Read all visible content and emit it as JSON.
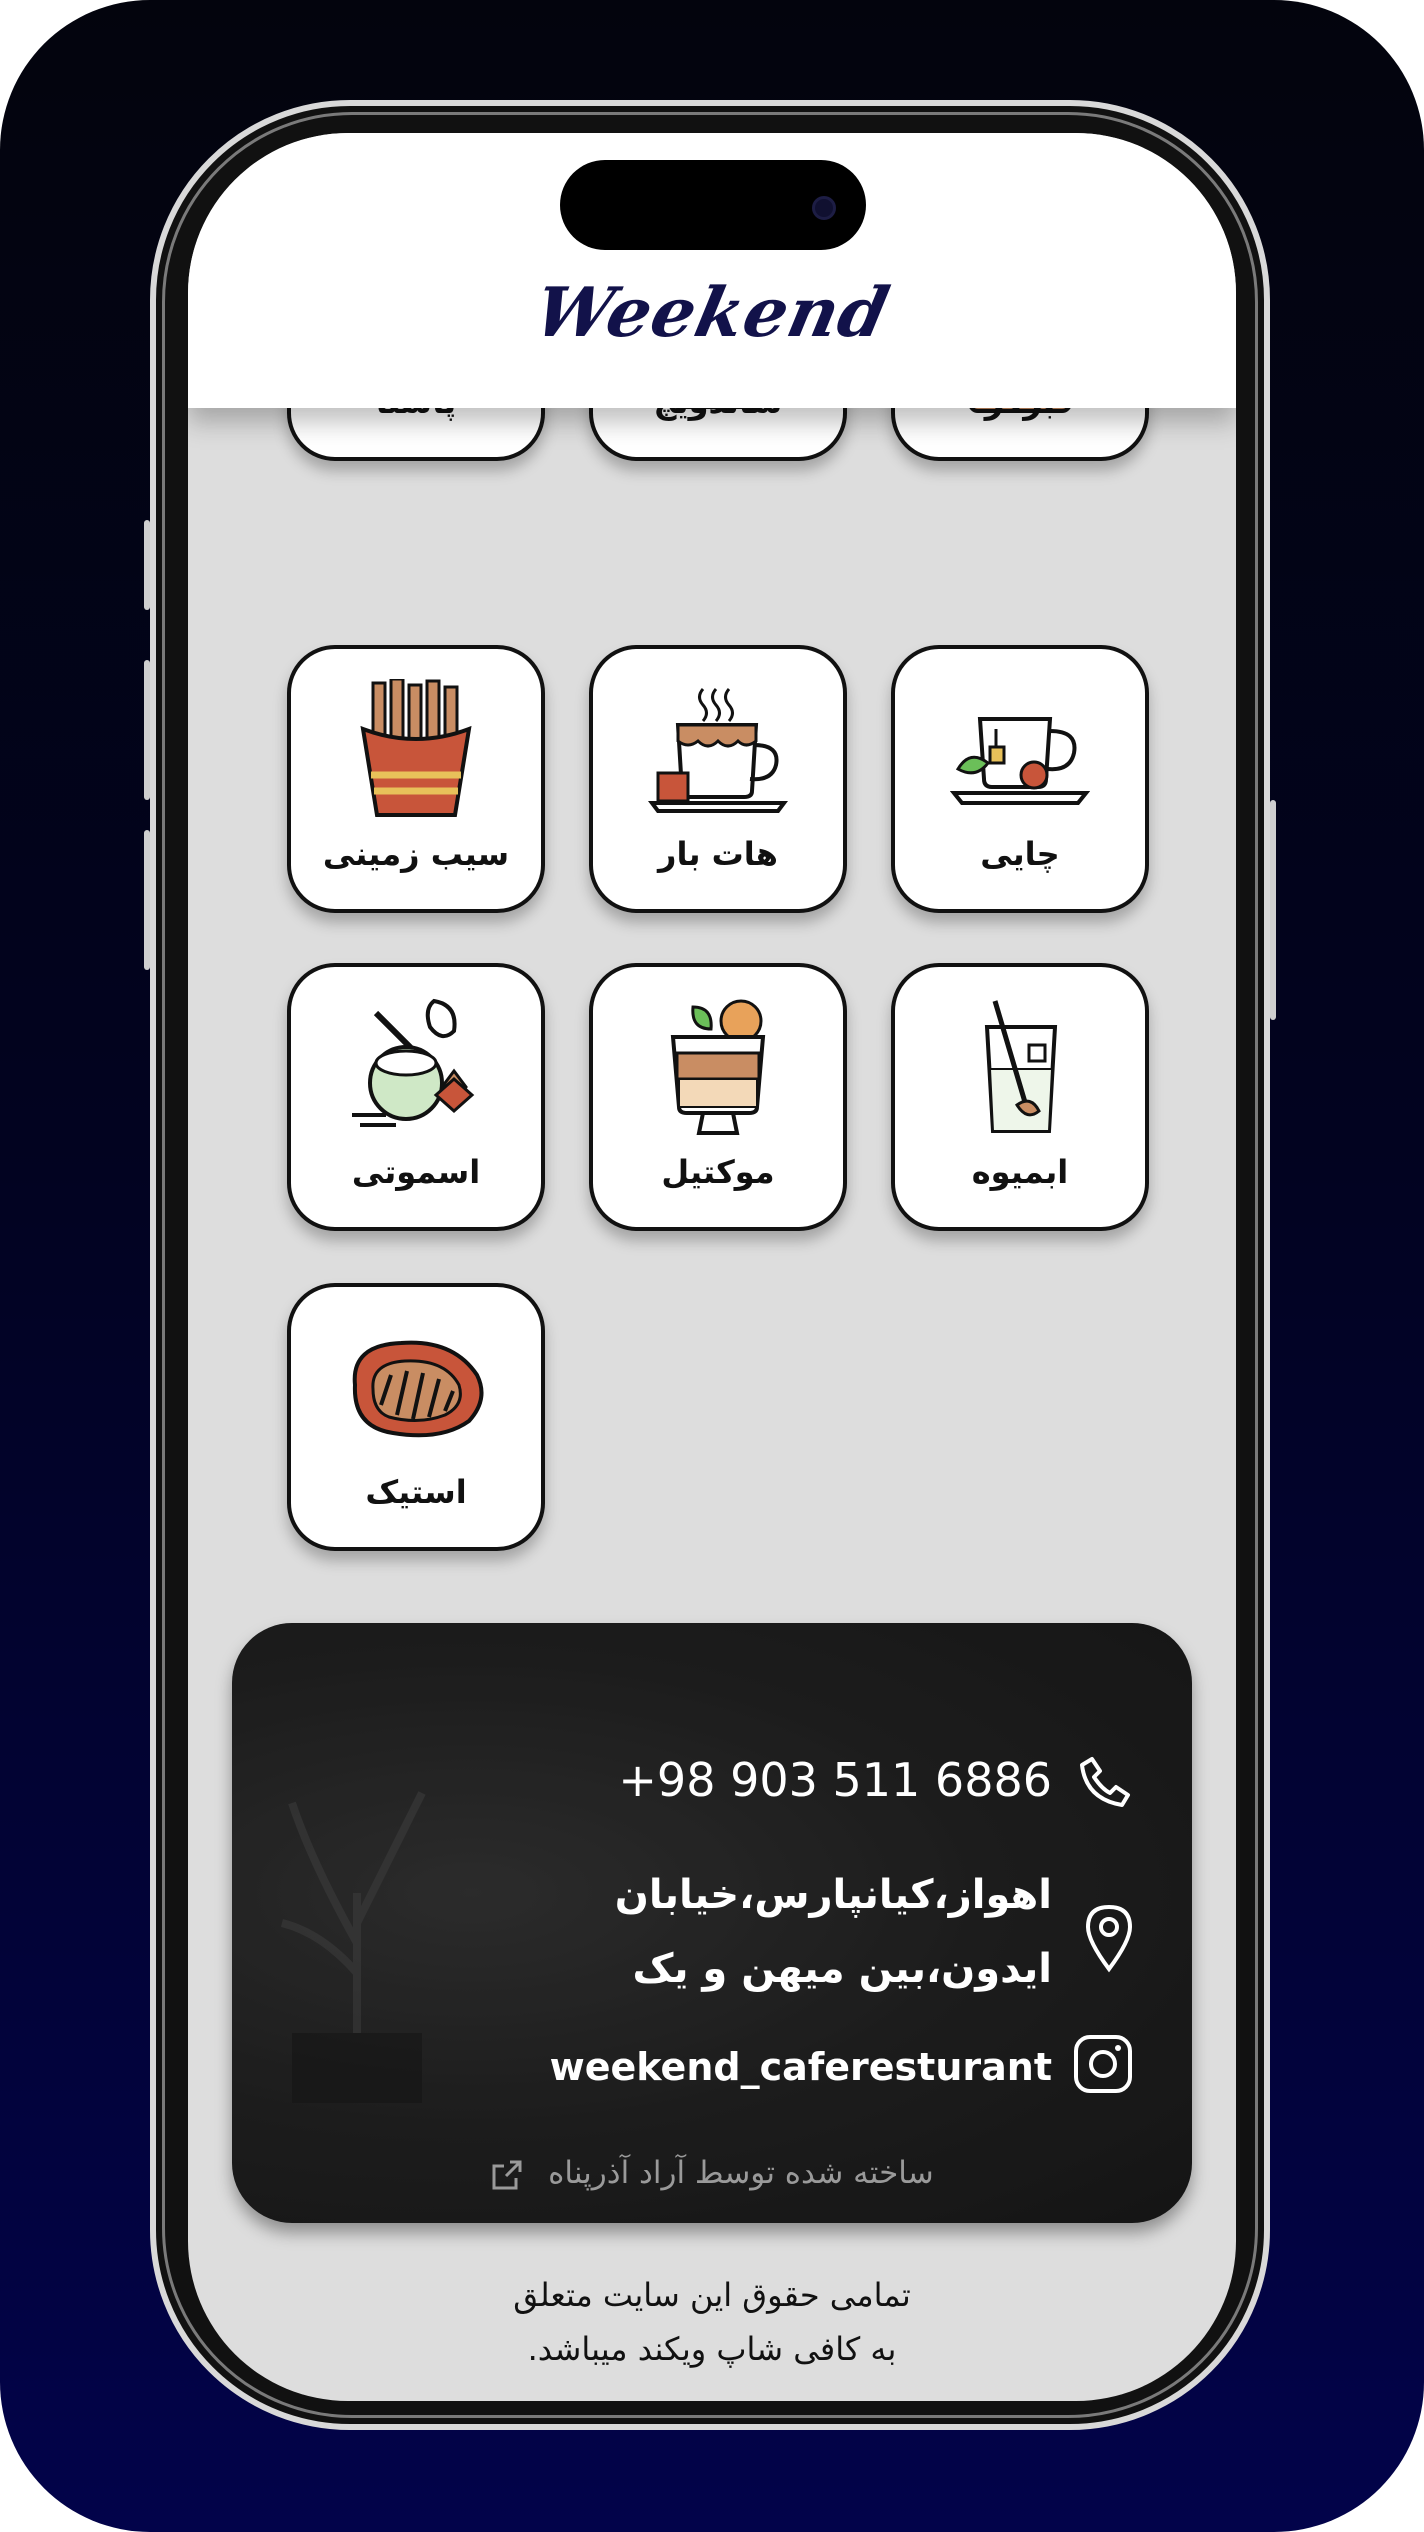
{
  "header": {
    "logo_text": "Weekend"
  },
  "categories": [
    {
      "label": "برگر",
      "icon": "burger-icon"
    },
    {
      "label": "ساندویچ",
      "icon": "sandwich-icon"
    },
    {
      "label": "پاستا",
      "icon": "pasta-icon"
    },
    {
      "label": "چایی",
      "icon": "tea-icon"
    },
    {
      "label": "هات بار",
      "icon": "hot-drink-icon"
    },
    {
      "label": "سیب زمینی",
      "icon": "fries-icon"
    },
    {
      "label": "ابمیوه",
      "icon": "juice-icon"
    },
    {
      "label": "موکتیل",
      "icon": "mocktail-icon"
    },
    {
      "label": "اسموتی",
      "icon": "smoothie-icon"
    },
    {
      "label": "استیک",
      "icon": "steak-icon"
    }
  ],
  "contact": {
    "phone": "+98 903 511 6886",
    "address_line1": "اهواز،کیانپارس،خیابان",
    "address_line2": "ایدون،بین میهن و یک",
    "instagram": "weekend_caferesturant",
    "credit": "ساخته شده توسط آراد آذرپناه"
  },
  "footer": {
    "line1": "تمامی حقوق این سایت متعلق",
    "line2": "به کافی شاپ ویکند میباشد."
  },
  "colors": {
    "frame_bg": "#02034a",
    "logo": "#12124a",
    "icon_orange": "#c8553a",
    "icon_brown": "#c98d63"
  }
}
